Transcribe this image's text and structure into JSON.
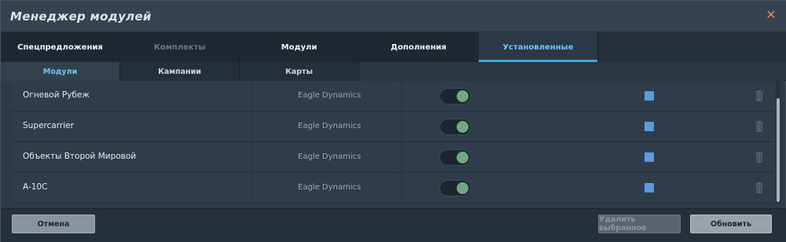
{
  "window": {
    "title": "Менеджер модулей"
  },
  "tabs": [
    {
      "label": "Спецпредложения"
    },
    {
      "label": "Комплекты"
    },
    {
      "label": "Модули"
    },
    {
      "label": "Дополнения"
    },
    {
      "label": "Установленные"
    }
  ],
  "subtabs": [
    {
      "label": "Модули"
    },
    {
      "label": "Кампании"
    },
    {
      "label": "Карты"
    }
  ],
  "rows": [
    {
      "name": "Огневой Рубеж",
      "author": "Eagle Dynamics",
      "enabled": true,
      "selected": true
    },
    {
      "name": "Supercarrier",
      "author": "Eagle Dynamics",
      "enabled": true,
      "selected": true
    },
    {
      "name": "Объекты Второй Мировой",
      "author": "Eagle Dynamics",
      "enabled": true,
      "selected": true
    },
    {
      "name": "A-10C",
      "author": "Eagle Dynamics",
      "enabled": true,
      "selected": true
    }
  ],
  "footer": {
    "cancel_label": "Отмена",
    "delete_label": "Удалить выбранное",
    "update_label": "Обновить"
  },
  "colors": {
    "accent": "#3aa7e0",
    "toggle_on": "#6fa983",
    "checkbox": "#5a9be0",
    "close": "#d98a5a"
  },
  "icons": {
    "close": "close-icon",
    "trash": "trash-icon"
  }
}
